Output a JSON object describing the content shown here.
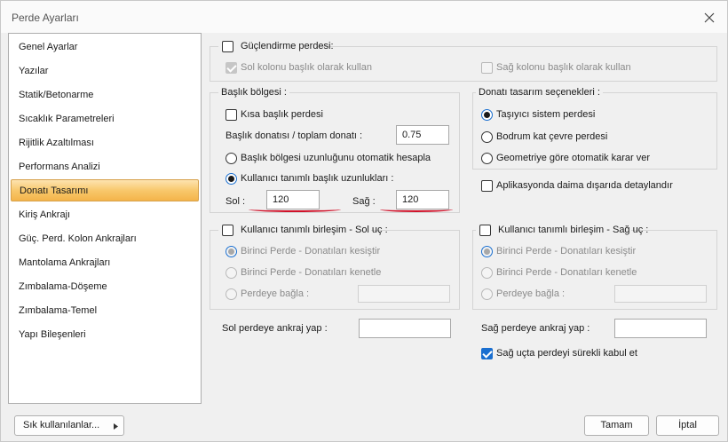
{
  "window": {
    "title": "Perde Ayarları"
  },
  "sidebar": {
    "items": [
      {
        "label": "Genel Ayarlar"
      },
      {
        "label": "Yazılar"
      },
      {
        "label": "Statik/Betonarme"
      },
      {
        "label": "Sıcaklık Parametreleri"
      },
      {
        "label": "Rijitlik Azaltılması"
      },
      {
        "label": "Performans Analizi"
      },
      {
        "label": "Donatı Tasarımı",
        "active": true
      },
      {
        "label": "Kiriş Ankrajı"
      },
      {
        "label": "Güç. Perd. Kolon Ankrajları"
      },
      {
        "label": "Mantolama Ankrajları"
      },
      {
        "label": "Zımbalama-Döşeme"
      },
      {
        "label": "Zımbalama-Temel"
      },
      {
        "label": "Yapı Bileşenleri"
      }
    ]
  },
  "strengthening": {
    "title": "Güçlendirme perdesi:",
    "left_col": "Sol kolonu başlık olarak kullan",
    "right_col": "Sağ kolonu başlık olarak kullan"
  },
  "header_region": {
    "legend": "Başlık bölgesi :",
    "short_header": "Kısa başlık perdesi",
    "ratio_label": "Başlık donatısı / toplam donatı :",
    "ratio_value": "0.75",
    "auto_calc": "Başlık bölgesi uzunluğunu otomatik hesapla",
    "user_defined": "Kullanıcı tanımlı başlık uzunlukları :",
    "left_label": "Sol :",
    "left_value": "120",
    "right_label": "Sağ :",
    "right_value": "120"
  },
  "design_options": {
    "legend": "Donatı tasarım seçenekleri :",
    "options": [
      "Taşıyıcı sistem perdesi",
      "Bodrum kat çevre perdesi",
      "Geometriye göre otomatik karar ver"
    ],
    "selected": 0
  },
  "detail_outside": "Aplikasyonda daima dışarıda detaylandır",
  "left_joint": {
    "title": "Kullanıcı tanımlı birleşim - Sol uç :",
    "opt1": "Birinci Perde - Donatıları kesiştir",
    "opt2": "Birinci Perde - Donatıları kenetle",
    "opt3": "Perdeye bağla :"
  },
  "right_joint": {
    "title": "Kullanıcı tanımlı birleşim - Sağ uç :",
    "opt1": "Birinci Perde - Donatıları kesiştir",
    "opt2": "Birinci Perde - Donatıları kenetle",
    "opt3": "Perdeye bağla :"
  },
  "anchorage": {
    "left_label": "Sol perdeye ankraj yap :",
    "left_value": "",
    "right_label": "Sağ perdeye ankraj yap :",
    "right_value": "",
    "continuous": "Sağ uçta perdeyi sürekli kabul et"
  },
  "footer": {
    "favorites": "Sık kullanılanlar...",
    "ok": "Tamam",
    "cancel": "İptal"
  },
  "colors": {
    "accent": "#1a6fd0",
    "active_item": "#f8c86c",
    "annotation": "#d0122a"
  },
  "icons": {
    "close": "close-icon",
    "dropdown": "triangle-right-icon"
  }
}
